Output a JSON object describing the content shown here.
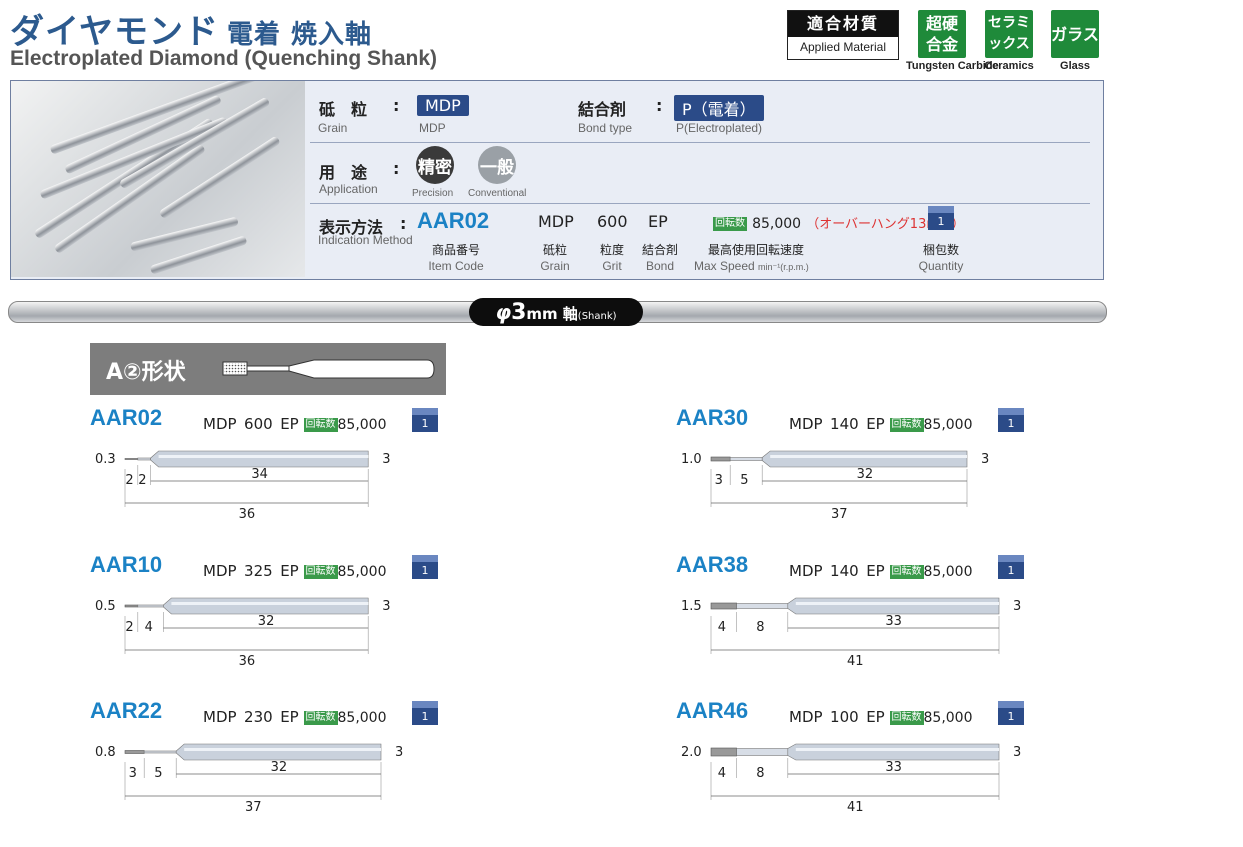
{
  "header": {
    "title_jp": "ダイヤモンド",
    "title_jp_sub": "電着 焼入軸",
    "title_en": "Electroplated Diamond (Quenching Shank)"
  },
  "applied_material": {
    "label_jp": "適合材質",
    "label_en": "Applied Material",
    "materials": [
      {
        "jp": "超硬合金",
        "en": "Tungsten Carbide"
      },
      {
        "jp": "セラミックス",
        "en": "Ceramics"
      },
      {
        "jp": "ガラス",
        "en": "Glass"
      }
    ],
    "color": "#1f8a3a"
  },
  "specs": {
    "grain_jp": "砥　粒",
    "grain_en": "Grain",
    "grain_value": "MDP",
    "grain_value_en": "MDP",
    "bond_jp": "結合剤",
    "bond_en": "Bond type",
    "bond_value": "P（電着）",
    "bond_value_en": "P(Electroplated)",
    "application_jp": "用　途",
    "application_en": "Application",
    "precision_jp": "精密",
    "precision_en": "Precision",
    "conventional_jp": "一般",
    "conventional_en": "Conventional",
    "indication_jp": "表示方法",
    "indication_en": "Indication Method",
    "example_code": "AAR02",
    "example_grain": "MDP",
    "example_grit": "600",
    "example_bond": "EP",
    "rpm_badge": "回転数",
    "example_rpm": "85,000",
    "overhang_note": "（オーバーハング13mm）",
    "example_qty": "1",
    "cap_item_jp": "商品番号",
    "cap_item_en": "Item Code",
    "cap_grain_jp": "砥粒",
    "cap_grain_en": "Grain",
    "cap_grit_jp": "粒度",
    "cap_grit_en": "Grit",
    "cap_bond_jp": "結合剤",
    "cap_bond_en": "Bond",
    "cap_speed_jp": "最高使用回転速度",
    "cap_speed_en": "Max Speed",
    "cap_speed_unit": "min⁻¹(r.p.m.)",
    "cap_qty_jp": "梱包数",
    "cap_qty_en": "Quantity"
  },
  "shank": {
    "phi": "φ",
    "size": "3",
    "unit": "mm",
    "axis_jp": "軸",
    "axis_en": "(Shank)"
  },
  "section": {
    "title": "A②形状"
  },
  "products": [
    {
      "code": "AAR02",
      "grain": "MDP",
      "grit": "600",
      "bond": "EP",
      "rpm": "85,000",
      "qty": "1",
      "tip_dia": "0.3",
      "shank_dia": "3",
      "d1": "2",
      "d2": "2",
      "d3": "34",
      "total": "36"
    },
    {
      "code": "AAR10",
      "grain": "MDP",
      "grit": "325",
      "bond": "EP",
      "rpm": "85,000",
      "qty": "1",
      "tip_dia": "0.5",
      "shank_dia": "3",
      "d1": "2",
      "d2": "4",
      "d3": "32",
      "total": "36"
    },
    {
      "code": "AAR22",
      "grain": "MDP",
      "grit": "230",
      "bond": "EP",
      "rpm": "85,000",
      "qty": "1",
      "tip_dia": "0.8",
      "shank_dia": "3",
      "d1": "3",
      "d2": "5",
      "d3": "32",
      "total": "37"
    },
    {
      "code": "AAR30",
      "grain": "MDP",
      "grit": "140",
      "bond": "EP",
      "rpm": "85,000",
      "qty": "1",
      "tip_dia": "1.0",
      "shank_dia": "3",
      "d1": "3",
      "d2": "5",
      "d3": "32",
      "total": "37"
    },
    {
      "code": "AAR38",
      "grain": "MDP",
      "grit": "140",
      "bond": "EP",
      "rpm": "85,000",
      "qty": "1",
      "tip_dia": "1.5",
      "shank_dia": "3",
      "d1": "4",
      "d2": "8",
      "d3": "33",
      "total": "41"
    },
    {
      "code": "AAR46",
      "grain": "MDP",
      "grit": "100",
      "bond": "EP",
      "rpm": "85,000",
      "qty": "1",
      "tip_dia": "2.0",
      "shank_dia": "3",
      "d1": "4",
      "d2": "8",
      "d3": "33",
      "total": "41"
    }
  ]
}
